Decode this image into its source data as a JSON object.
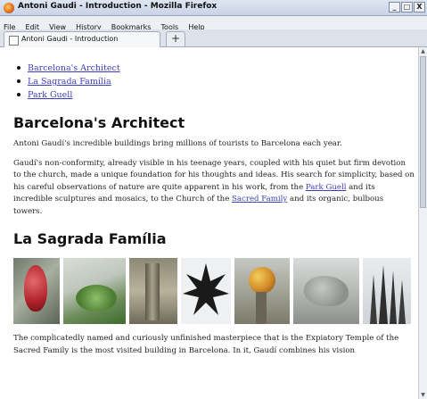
{
  "window": {
    "title": "Antoni Gaudi - Introduction - Mozilla Firefox",
    "controls": {
      "minimize": "_",
      "maximize": "□",
      "close": "X"
    }
  },
  "menu": [
    "File",
    "Edit",
    "View",
    "History",
    "Bookmarks",
    "Tools",
    "Help"
  ],
  "tabs": [
    {
      "label": "Antoni Gaudi - Introduction"
    }
  ],
  "new_tab_label": "+",
  "page": {
    "toc": [
      "Barcelona's Architect",
      "La Sagrada Família",
      "Park Guell"
    ],
    "section1": {
      "heading": "Barcelona's Architect",
      "p1": "Antoni Gaudí's incredible buildings bring millions of tourists to Barcelona each year.",
      "p2_a": "Gaudí's non-conformity, already visible in his teenage years, coupled with his quiet but firm devotion to the church, made a unique foundation for his thoughts and ideas. His search for simplicity, based on his careful observations of nature are quite apparent in his work, from the ",
      "p2_link1": "Park Guell",
      "p2_b": " and its incredible sculptures and mosaics, to the Church of the ",
      "p2_link2": "Sacred Family",
      "p2_c": " and its organic, bulbous towers."
    },
    "section2": {
      "heading": "La Sagrada Família",
      "p1": "The complicatedly named and curiously unfinished masterpiece that is the Expiatory Temple of the Sacred Family is the most visited building in Barcelona. In it, Gaudí combines his vision"
    }
  }
}
